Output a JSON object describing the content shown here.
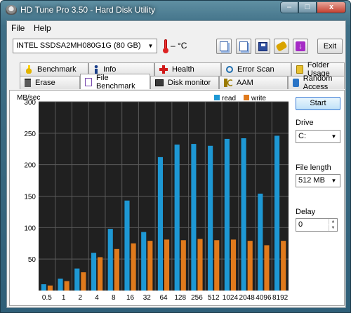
{
  "window": {
    "title": "HD Tune Pro 3.50 - Hard Disk Utility"
  },
  "menu": {
    "file": "File",
    "help": "Help"
  },
  "toolbar": {
    "drive": "INTEL SSDSA2MH080G1G (80 GB)",
    "temperature": "– °C",
    "exit_label": "Exit"
  },
  "tabs_top": [
    {
      "label": "Benchmark",
      "icon": "thermometer-icon"
    },
    {
      "label": "Info",
      "icon": "info-icon"
    },
    {
      "label": "Health",
      "icon": "health-cross-icon"
    },
    {
      "label": "Error Scan",
      "icon": "magnifier-icon"
    },
    {
      "label": "Folder Usage",
      "icon": "folder-icon"
    }
  ],
  "tabs_bottom": [
    {
      "label": "Erase",
      "icon": "trash-icon"
    },
    {
      "label": "File Benchmark",
      "icon": "file-benchmark-icon"
    },
    {
      "label": "Disk monitor",
      "icon": "disk-monitor-icon"
    },
    {
      "label": "AAM",
      "icon": "speaker-icon"
    },
    {
      "label": "Random Access",
      "icon": "random-access-icon"
    }
  ],
  "controls": {
    "start_label": "Start",
    "drive_label": "Drive",
    "drive_value": "C:",
    "file_length_label": "File length",
    "file_length_value": "512 MB",
    "delay_label": "Delay",
    "delay_value": "0"
  },
  "chart_data": {
    "type": "bar",
    "ylabel": "MB/sec",
    "ylim": [
      0,
      300
    ],
    "yticks": [
      50,
      100,
      150,
      200,
      250,
      300
    ],
    "grid": true,
    "legend_placement": "top-right",
    "categories": [
      "0.5",
      "1",
      "2",
      "4",
      "8",
      "16",
      "32",
      "64",
      "128",
      "256",
      "512",
      "1024",
      "2048",
      "4096",
      "8192"
    ],
    "series": [
      {
        "name": "read",
        "color": "#1e98d4",
        "values": [
          10,
          19,
          35,
          60,
          98,
          143,
          93,
          212,
          232,
          233,
          230,
          241,
          242,
          154,
          246
        ]
      },
      {
        "name": "write",
        "color": "#e07a1c",
        "values": [
          8,
          15,
          29,
          53,
          66,
          75,
          79,
          81,
          80,
          82,
          80,
          81,
          79,
          72,
          79
        ]
      }
    ]
  }
}
